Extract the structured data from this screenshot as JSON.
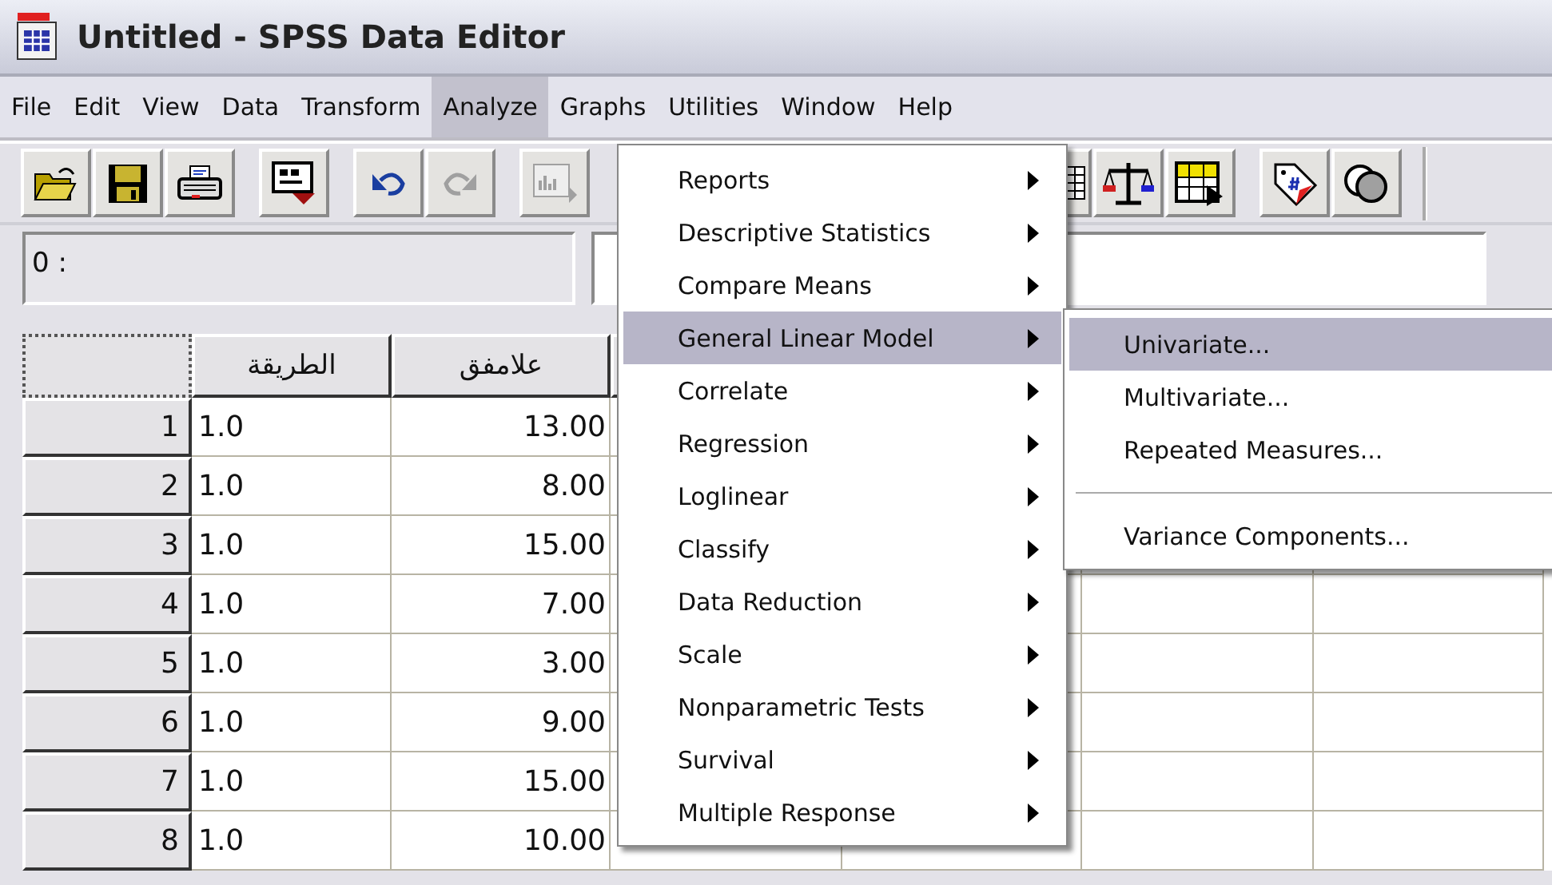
{
  "window": {
    "title": "Untitled - SPSS Data Editor"
  },
  "menu_bar": [
    {
      "label": "File",
      "selected": false
    },
    {
      "label": "Edit",
      "selected": false
    },
    {
      "label": "View",
      "selected": false
    },
    {
      "label": "Data",
      "selected": false
    },
    {
      "label": "Transform",
      "selected": false
    },
    {
      "label": "Analyze",
      "selected": true
    },
    {
      "label": "Graphs",
      "selected": false
    },
    {
      "label": "Utilities",
      "selected": false
    },
    {
      "label": "Window",
      "selected": false
    },
    {
      "label": "Help",
      "selected": false
    }
  ],
  "cell_editor": {
    "label": "0 :"
  },
  "grid": {
    "columns": [
      "الطريقة",
      "علامفق"
    ],
    "rows": [
      {
        "number": "1",
        "cells": [
          "1.0",
          "13.00"
        ]
      },
      {
        "number": "2",
        "cells": [
          "1.0",
          "8.00"
        ]
      },
      {
        "number": "3",
        "cells": [
          "1.0",
          "15.00"
        ]
      },
      {
        "number": "4",
        "cells": [
          "1.0",
          "7.00"
        ]
      },
      {
        "number": "5",
        "cells": [
          "1.0",
          "3.00"
        ]
      },
      {
        "number": "6",
        "cells": [
          "1.0",
          "9.00"
        ]
      },
      {
        "number": "7",
        "cells": [
          "1.0",
          "15.00"
        ]
      },
      {
        "number": "8",
        "cells": [
          "1.0",
          "10.00"
        ]
      }
    ]
  },
  "analyze_menu": [
    {
      "label": "Reports",
      "selected": false
    },
    {
      "label": "Descriptive Statistics",
      "selected": false
    },
    {
      "label": "Compare Means",
      "selected": false
    },
    {
      "label": "General Linear Model",
      "selected": true
    },
    {
      "label": "Correlate",
      "selected": false
    },
    {
      "label": "Regression",
      "selected": false
    },
    {
      "label": "Loglinear",
      "selected": false
    },
    {
      "label": "Classify",
      "selected": false
    },
    {
      "label": "Data Reduction",
      "selected": false
    },
    {
      "label": "Scale",
      "selected": false
    },
    {
      "label": "Nonparametric Tests",
      "selected": false
    },
    {
      "label": "Survival",
      "selected": false
    },
    {
      "label": "Multiple Response",
      "selected": false
    }
  ],
  "submenu": [
    {
      "kind": "item",
      "label": "Univariate...",
      "selected": true
    },
    {
      "kind": "item",
      "label": "Multivariate...",
      "selected": false
    },
    {
      "kind": "item",
      "label": "Repeated Measures...",
      "selected": false
    },
    {
      "kind": "separator"
    },
    {
      "kind": "item",
      "label": "Variance Components...",
      "selected": false
    }
  ]
}
